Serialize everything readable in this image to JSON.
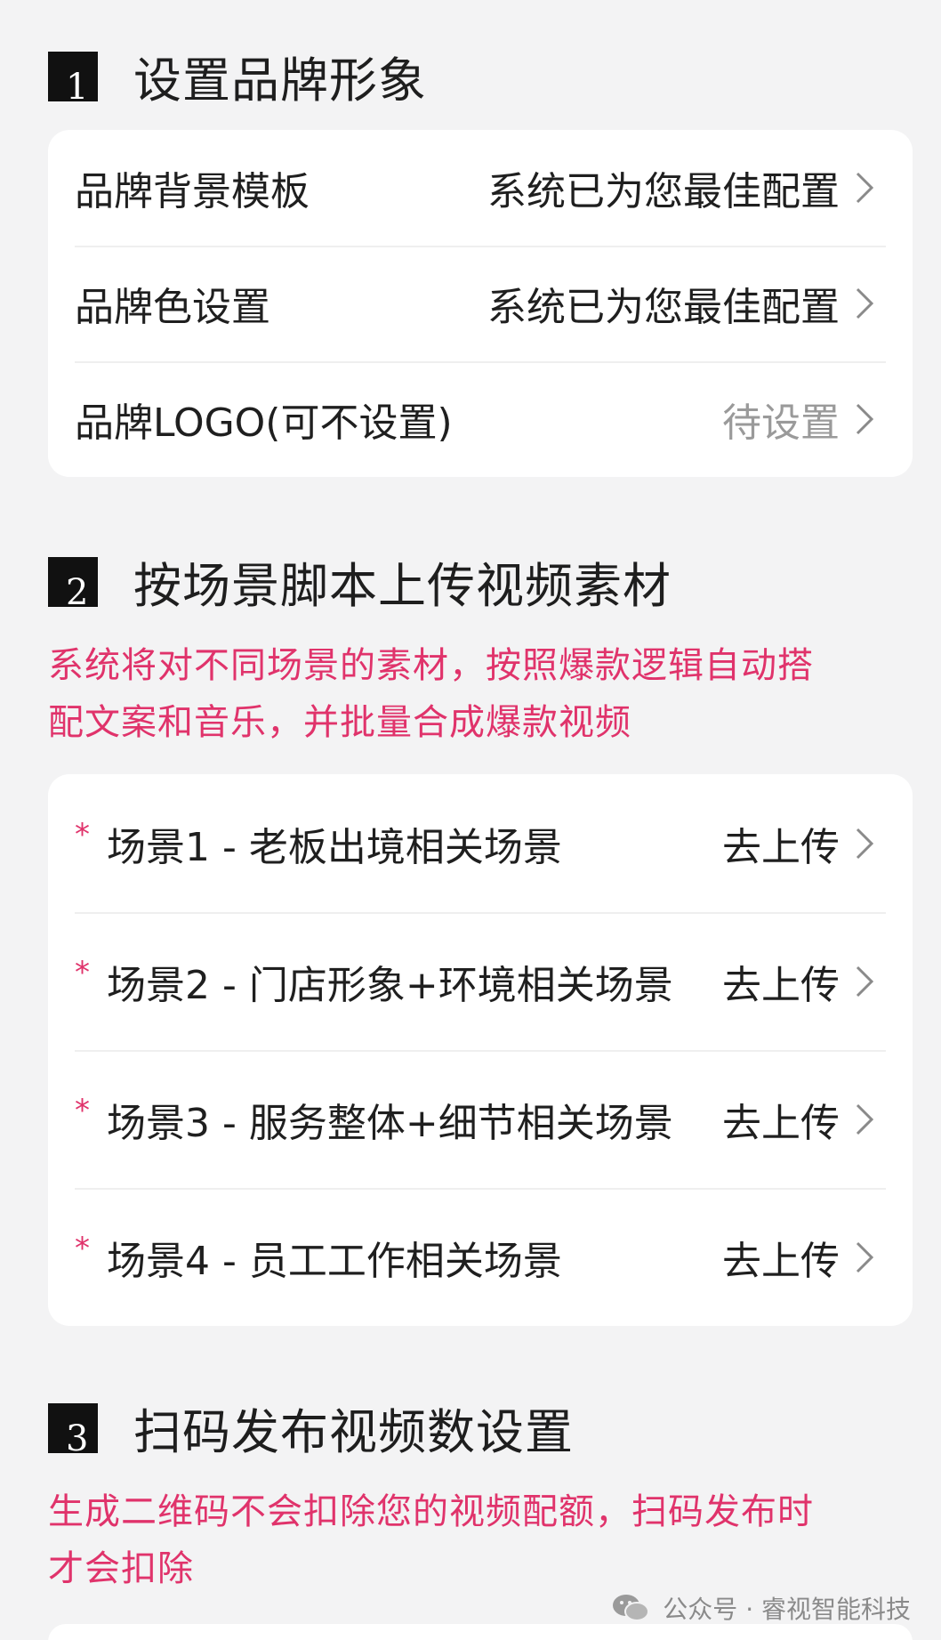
{
  "sections": [
    {
      "number": "1",
      "title": "设置品牌形象",
      "rows": [
        {
          "label": "品牌背景模板",
          "value": "系统已为您最佳配置"
        },
        {
          "label": "品牌色设置",
          "value": "系统已为您最佳配置"
        },
        {
          "label": "品牌LOGO(可不设置)",
          "value": "待设置"
        }
      ]
    },
    {
      "number": "2",
      "title": "按场景脚本上传视频素材",
      "note_line1": "系统将对不同场景的素材，按照爆款逻辑自动搭",
      "note_line2": "配文案和音乐，并批量合成爆款视频",
      "required_mark": "*",
      "rows": [
        {
          "label": "场景1 - 老板出境相关场景",
          "value": "去上传"
        },
        {
          "label": "场景2 - 门店形象+环境相关场景",
          "value": "去上传"
        },
        {
          "label": "场景3 - 服务整体+细节相关场景",
          "value": "去上传"
        },
        {
          "label": "场景4 - 员工工作相关场景",
          "value": "去上传"
        }
      ]
    },
    {
      "number": "3",
      "title": "扫码发布视频数设置",
      "note_line1": "生成二维码不会扣除您的视频配额，扫码发布时",
      "note_line2": "才会扣除"
    }
  ],
  "watermark": {
    "text": "公众号 · 睿视智能科技",
    "icon": "wechat-icon"
  },
  "colors": {
    "accent": "#e0336b",
    "background": "#f3f3f4",
    "card": "#ffffff",
    "muted": "#9a9a9a"
  }
}
